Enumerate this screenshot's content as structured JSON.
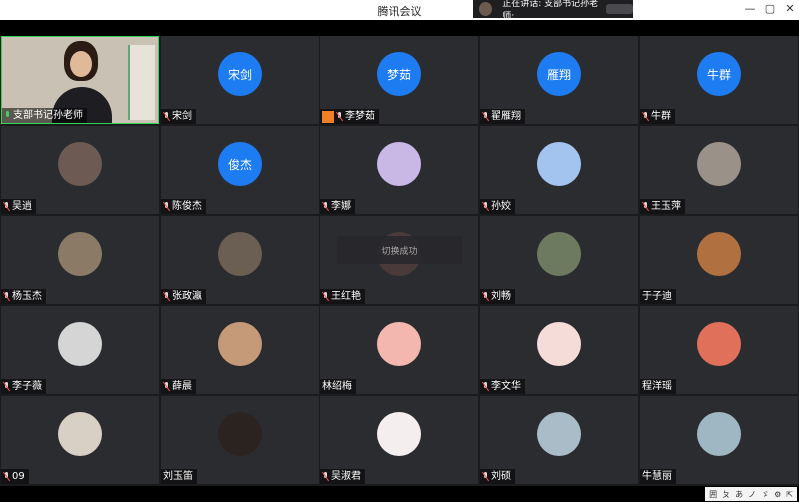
{
  "window": {
    "title": "腾讯会议",
    "speaking_label": "正在讲话: 支部书记孙老师;",
    "controls": {
      "minimize": "—",
      "maximize": "▢",
      "close": "✕"
    }
  },
  "toast": "切换成功",
  "participants": [
    {
      "name": "支部书记孙老师",
      "avatar": "camera",
      "mic": "on"
    },
    {
      "name": "宋剑",
      "avatar_text": "宋剑",
      "mic": "off"
    },
    {
      "name": "李梦茹",
      "avatar_text": "梦茹",
      "mic": "off",
      "badge": "host-icon"
    },
    {
      "name": "翟雁翔",
      "avatar_text": "雁翔",
      "mic": "off"
    },
    {
      "name": "牛群",
      "avatar_text": "牛群",
      "mic": "off"
    },
    {
      "name": "吴逍",
      "avatar": "photo",
      "avatar_color": "#6c5a53",
      "mic": "off"
    },
    {
      "name": "陈俊杰",
      "avatar_text": "俊杰",
      "mic": "off"
    },
    {
      "name": "李娜",
      "avatar": "photo",
      "avatar_color": "#c9b8e6",
      "mic": "off"
    },
    {
      "name": "孙姣",
      "avatar": "photo",
      "avatar_color": "#a3c4ee",
      "mic": "off"
    },
    {
      "name": "王玉萍",
      "avatar": "photo",
      "avatar_color": "#9a9288",
      "mic": "off"
    },
    {
      "name": "杨玉杰",
      "avatar": "photo",
      "avatar_color": "#8a7a66",
      "mic": "off"
    },
    {
      "name": "张政瀛",
      "avatar": "photo",
      "avatar_color": "#6b5e52",
      "mic": "off"
    },
    {
      "name": "王红艳",
      "avatar": "photo",
      "avatar_color": "#4a3b3a",
      "mic": "off"
    },
    {
      "name": "刘畅",
      "avatar": "photo",
      "avatar_color": "#6d7a60",
      "mic": "off"
    },
    {
      "name": "于子迪",
      "avatar": "photo",
      "avatar_color": "#b07040",
      "mic": "none"
    },
    {
      "name": "李子薇",
      "avatar": "photo",
      "avatar_color": "#d5d5d5",
      "mic": "off"
    },
    {
      "name": "薛晨",
      "avatar": "photo",
      "avatar_color": "#c49a78",
      "mic": "off"
    },
    {
      "name": "林绍梅",
      "avatar": "photo",
      "avatar_color": "#f3b7b0",
      "mic": "none"
    },
    {
      "name": "李文华",
      "avatar": "photo",
      "avatar_color": "#f6dcd8",
      "mic": "off"
    },
    {
      "name": "程洋瑶",
      "avatar": "photo",
      "avatar_color": "#e0705a",
      "mic": "none"
    },
    {
      "name": "09",
      "avatar": "photo",
      "avatar_color": "#d8cfc5",
      "mic": "off"
    },
    {
      "name": "刘玉笛",
      "avatar": "photo",
      "avatar_color": "#2a2320",
      "mic": "none"
    },
    {
      "name": "吴淑君",
      "avatar": "photo",
      "avatar_color": "#f4eeee",
      "mic": "off"
    },
    {
      "name": "刘硕",
      "avatar": "photo",
      "avatar_color": "#a9bcc8",
      "mic": "off"
    },
    {
      "name": "牛慧丽",
      "avatar": "photo",
      "avatar_color": "#9eb7c2",
      "mic": "none"
    }
  ],
  "ime": {
    "items": [
      "囲",
      "ㄆ",
      "あ",
      "ノ",
      "ゞ",
      "⚙",
      "⇱"
    ]
  },
  "colors": {
    "tile": "#2b2c30",
    "text_avatar": "#1e7cf2",
    "active_border": "#33d45a",
    "background": "#1b1b1d"
  }
}
